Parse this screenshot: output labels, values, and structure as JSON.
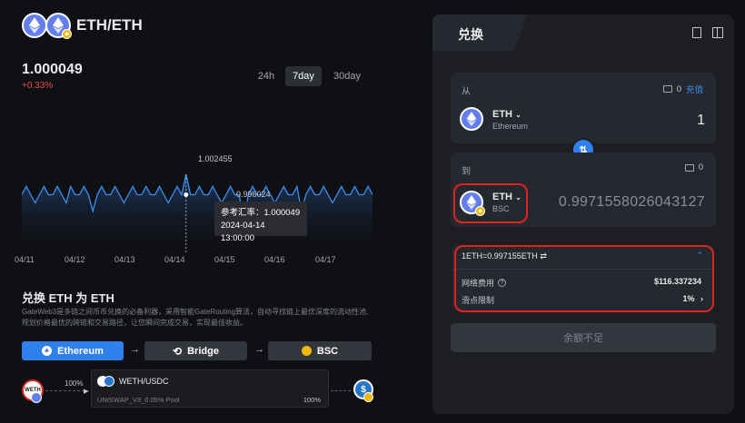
{
  "header": {
    "pair": "ETH/ETH"
  },
  "rate": {
    "value": "1.000049",
    "change": "+0.33%",
    "change_color": "#f04a4a"
  },
  "timeframes": [
    {
      "label": "24h",
      "active": false
    },
    {
      "label": "7day",
      "active": true
    },
    {
      "label": "30day",
      "active": false
    }
  ],
  "chart_data": {
    "type": "line",
    "series": [
      {
        "values": [
          1.0,
          1.001,
          1.0,
          0.999,
          1.0,
          1.001,
          1.0,
          1.0,
          1.001,
          1.0,
          0.999,
          1.001,
          1.0,
          1.0,
          1.001,
          1.0,
          0.998,
          1.0,
          1.001,
          1.0,
          1.0,
          1.001,
          1.0,
          0.999,
          1.0,
          1.001,
          1.0,
          1.0,
          1.001,
          1.0,
          1.0,
          1.001,
          1.0,
          0.999,
          1.0,
          1.001,
          1.0,
          1.002455,
          1.0,
          1.0,
          1.001,
          1.0,
          1.0,
          1.001,
          1.0,
          0.999,
          1.0,
          1.001,
          1.0,
          1.0,
          0.996024,
          1.0,
          1.001,
          1.0,
          1.0,
          1.001,
          1.0,
          0.999,
          1.0,
          1.001,
          1.0,
          1.0,
          1.001,
          0.998,
          1.0,
          1.001,
          1.0,
          1.0,
          1.001,
          1.0,
          0.999,
          1.0,
          1.001,
          1.0,
          1.0,
          1.001,
          1.0,
          1.0,
          1.001,
          1.0
        ]
      }
    ],
    "x_ticks": [
      "04/11",
      "04/12",
      "04/13",
      "04/14",
      "04/15",
      "04/16",
      "04/17"
    ],
    "annotations": {
      "max": "1.002455",
      "min": "0.996024"
    },
    "ylim": [
      0.993,
      1.006
    ],
    "color": "#3d8ef0",
    "tooltip": {
      "line1": "参考汇率：1.000049",
      "line2": "2024-04-14 13:00:00"
    }
  },
  "swap_title": "兑换 ETH 为 ETH",
  "swap_desc_line1": "GateWeb3是多链之间币币兑换的必备利器，采用智能GateRouting算法，自动寻找链上最优深度的流动性池,",
  "swap_desc_line2": "规划价格最优的跨链和交易路径，让您瞬间完成交易，实现最佳收益。",
  "route": {
    "from_chain": "Ethereum",
    "bridge": "Bridge",
    "to_chain": "BSC",
    "arrow": "→"
  },
  "path": {
    "percent": "100%",
    "pool_pair": "WETH/USDC",
    "pool_detail": "UNISWAP_V3_0.05% Pool",
    "pool_percent": "100%",
    "start_token": "WETH",
    "end_token": "$"
  },
  "panel": {
    "tab": "兑换",
    "from": {
      "label": "从",
      "balance": "0",
      "deposit": "充值",
      "token": "ETH",
      "network": "Ethereum",
      "amount": "1"
    },
    "to": {
      "label": "到",
      "balance": "0",
      "token": "ETH",
      "network": "BSC",
      "amount": "0.9971558026043127"
    },
    "details": {
      "rate_text": "1ETH=0.997155ETH",
      "swap_icon": "⇄",
      "fee_label": "网络费用",
      "fee_value": "$116.337234",
      "slippage_label": "滑点限制",
      "slippage_value": "1%"
    },
    "submit": "余额不足"
  }
}
